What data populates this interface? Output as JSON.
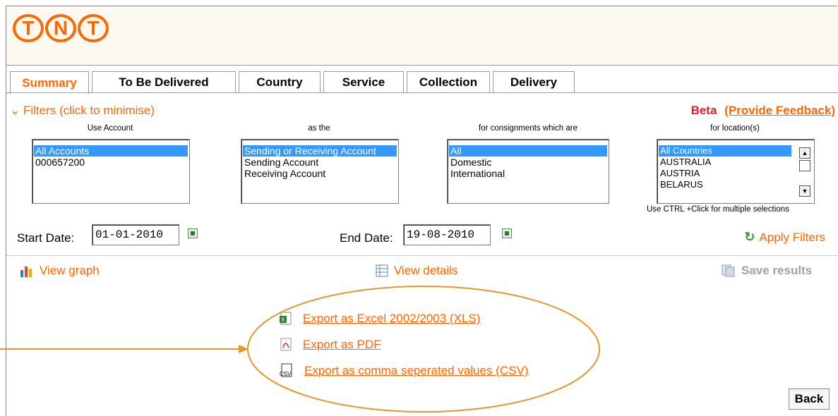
{
  "logo": {
    "letters": [
      "T",
      "N",
      "T"
    ]
  },
  "tabs": [
    {
      "label": "Summary",
      "active": true
    },
    {
      "label": "To Be Delivered"
    },
    {
      "label": "Country"
    },
    {
      "label": "Service"
    },
    {
      "label": "Collection"
    },
    {
      "label": "Delivery"
    }
  ],
  "filters": {
    "toggle_label": "Filters (click to minimise)",
    "beta_label": "Beta",
    "feedback_link": "(Provide Feedback)",
    "columns": [
      {
        "heading": "Use Account",
        "options": [
          "All Accounts",
          "000657200"
        ],
        "selected": "All Accounts"
      },
      {
        "heading": "as the",
        "options": [
          "Sending or Receiving Account",
          "Sending Account",
          "Receiving Account"
        ],
        "selected": "Sending or Receiving Account"
      },
      {
        "heading": "for consignments which are",
        "options": [
          "All",
          "Domestic",
          "International"
        ],
        "selected": "All"
      },
      {
        "heading": "for location(s)",
        "options": [
          "All Countries",
          "AUSTRALIA",
          "AUSTRIA",
          "BELARUS"
        ],
        "selected": "All Countries"
      }
    ],
    "multi_select_hint": "Use CTRL +Click for multiple selections",
    "start_date_label": "Start Date:",
    "start_date_value": "01-01-2010",
    "end_date_label": "End Date:",
    "end_date_value": "19-08-2010",
    "apply_label": "Apply Filters"
  },
  "actions": {
    "view_graph": "View graph",
    "view_details": "View details",
    "save_results": "Save results"
  },
  "exports": [
    {
      "label": "Export as Excel 2002/2003 (XLS)",
      "icon": "excel-icon"
    },
    {
      "label": "Export as PDF",
      "icon": "pdf-icon"
    },
    {
      "label": "Export as comma seperated values (CSV)",
      "icon": "csv-icon"
    }
  ],
  "back_label": "Back",
  "colors": {
    "accent": "#ff6600",
    "beta": "#e41c23",
    "annotation": "#e8962a"
  }
}
